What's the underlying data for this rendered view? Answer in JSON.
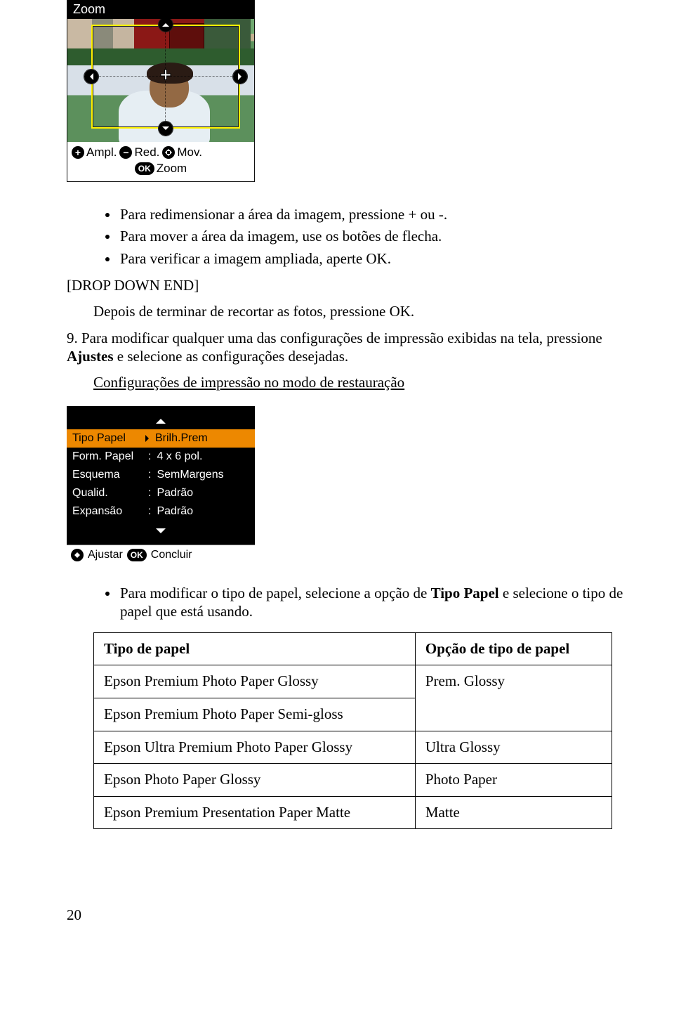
{
  "zoom_panel": {
    "title": "Zoom",
    "controls": {
      "ampl": "Ampl.",
      "red": "Red.",
      "mov": "Mov.",
      "ok": "OK",
      "zoom": "Zoom"
    }
  },
  "bullets1": [
    "Para redimensionar a área da imagem, pressione + ou -.",
    "Para mover a área da imagem, use os botões de flecha.",
    "Para verificar a imagem ampliada, aperte OK."
  ],
  "drop_end": "[DROP DOWN END]",
  "after_drop": "Depois de terminar de recortar as fotos, pressione OK.",
  "step9_pre": "9. Para modificar qualquer uma das configurações de impressão exibidas na tela, pressione ",
  "step9_bold": "Ajustes",
  "step9_post": " e selecione as configurações desejadas.",
  "config_link": "Configurações de impressão no modo de restauração",
  "settings_panel": {
    "rows": [
      {
        "label": "Tipo Papel",
        "value": "Brilh.Prem",
        "selected": true,
        "arrow": true
      },
      {
        "label": "Form. Papel",
        "value": "4 x 6 pol.",
        "selected": false
      },
      {
        "label": "Esquema",
        "value": "SemMargens",
        "selected": false
      },
      {
        "label": "Qualid.",
        "value": "Padrão",
        "selected": false
      },
      {
        "label": "Expansão",
        "value": "Padrão",
        "selected": false
      }
    ],
    "footer": {
      "adjust": "Ajustar",
      "ok": "OK",
      "done": "Concluir"
    }
  },
  "bullet2_pre": "Para modificar o tipo de papel, selecione a opção de ",
  "bullet2_bold": "Tipo Papel",
  "bullet2_post": " e selecione o tipo de papel que está usando.",
  "table": {
    "headers": [
      "Tipo de papel",
      "Opção de tipo de papel"
    ],
    "rows": [
      [
        "Epson Premium Photo Paper Glossy",
        "Prem. Glossy"
      ],
      [
        "Epson Premium Photo Paper Semi-gloss",
        ""
      ],
      [
        "Epson Ultra Premium Photo Paper Glossy",
        "Ultra Glossy"
      ],
      [
        "Epson Photo Paper Glossy",
        "Photo Paper"
      ],
      [
        "Epson Premium Presentation Paper Matte",
        "Matte"
      ]
    ],
    "merge_col2_rows_0_1": true
  },
  "page_number": "20"
}
